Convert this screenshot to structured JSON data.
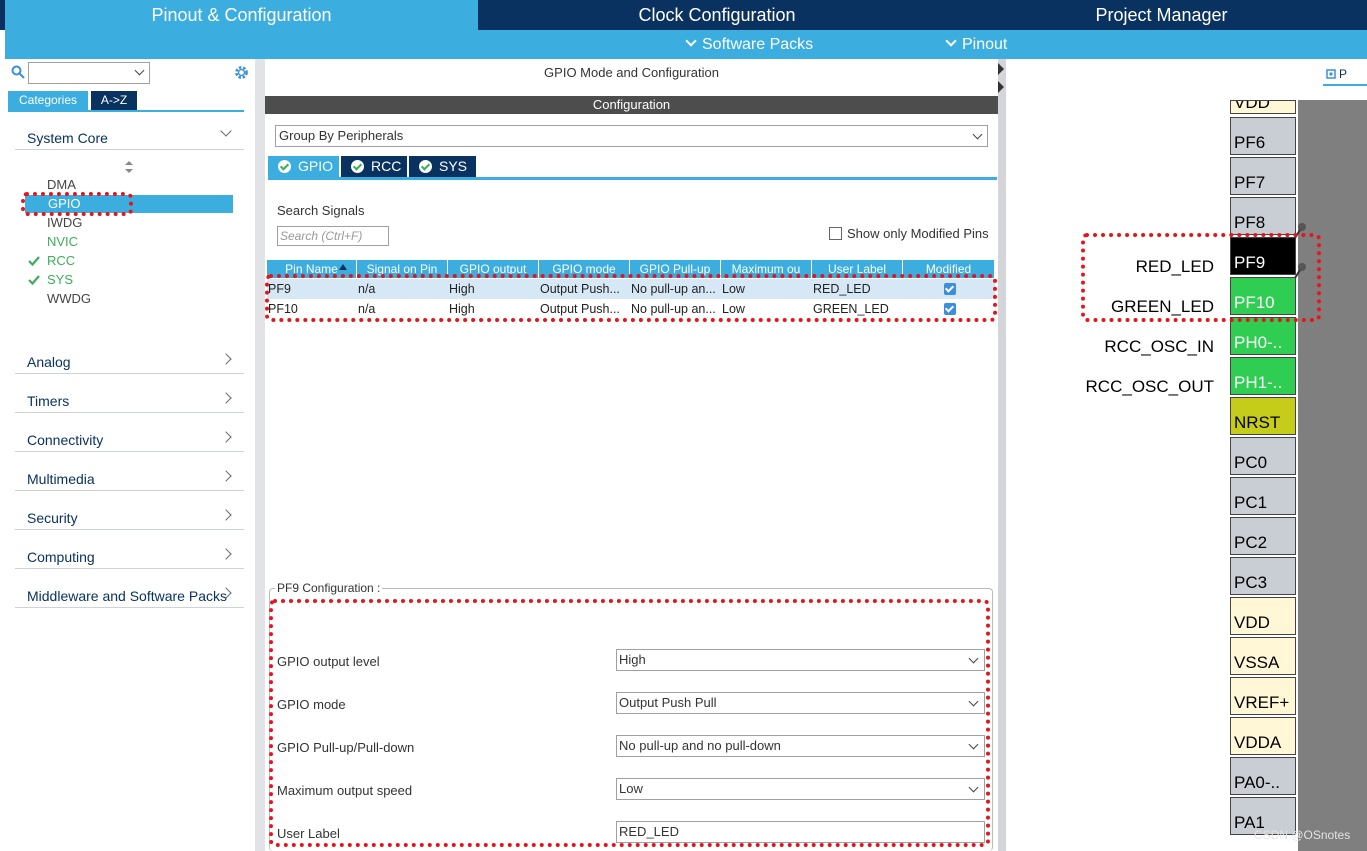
{
  "top_tabs": [
    "Pinout & Configuration",
    "Clock Configuration",
    "Project Manager"
  ],
  "sub_menu": [
    "Software Packs",
    "Pinout"
  ],
  "left": {
    "search_value": "",
    "category_tabs": [
      "Categories",
      "A->Z"
    ],
    "system_core_label": "System Core",
    "core_items": [
      {
        "label": "DMA",
        "state": "normal"
      },
      {
        "label": "GPIO",
        "state": "selected"
      },
      {
        "label": "IWDG",
        "state": "normal"
      },
      {
        "label": "NVIC",
        "state": "green"
      },
      {
        "label": "RCC",
        "state": "checked"
      },
      {
        "label": "SYS",
        "state": "checked"
      },
      {
        "label": "WWDG",
        "state": "normal"
      }
    ],
    "categories": [
      "Analog",
      "Timers",
      "Connectivity",
      "Multimedia",
      "Security",
      "Computing",
      "Middleware and Software Packs"
    ]
  },
  "center": {
    "header": "GPIO Mode and Configuration",
    "config_bar": "Configuration",
    "group_select": "Group By Peripherals",
    "periph_tabs": [
      "GPIO",
      "RCC",
      "SYS"
    ],
    "search_signals_label": "Search Signals",
    "search_placeholder": "Search (Ctrl+F)",
    "show_modified_label": "Show only Modified Pins",
    "table_headers": [
      "Pin Name",
      "Signal on Pin",
      "GPIO output",
      "GPIO mode",
      "GPIO Pull-up",
      "Maximum ou",
      "User Label",
      "Modified"
    ],
    "rows": [
      [
        "PF9",
        "n/a",
        "High",
        "Output Push...",
        "No pull-up an...",
        "Low",
        "RED_LED",
        "true"
      ],
      [
        "PF10",
        "n/a",
        "High",
        "Output Push...",
        "No pull-up an...",
        "Low",
        "GREEN_LED",
        "true"
      ]
    ],
    "pin_config_title": "PF9 Configuration :",
    "pin_config": [
      {
        "label": "GPIO output level",
        "value": "High",
        "type": "select"
      },
      {
        "label": "GPIO mode",
        "value": "Output Push Pull",
        "type": "select"
      },
      {
        "label": "GPIO Pull-up/Pull-down",
        "value": "No pull-up and no pull-down",
        "type": "select"
      },
      {
        "label": "Maximum output speed",
        "value": "Low",
        "type": "select"
      },
      {
        "label": "User Label",
        "value": "RED_LED",
        "type": "text"
      }
    ]
  },
  "right": {
    "view_tab": "P",
    "pins": [
      {
        "name": "VDD",
        "color": "#fff7d6"
      },
      {
        "name": "PF6",
        "color": "#c9ced4"
      },
      {
        "name": "PF7",
        "color": "#c9ced4"
      },
      {
        "name": "PF8",
        "color": "#c9ced4"
      },
      {
        "name": "PF9",
        "color": "#000000",
        "text_color": "#ffffff",
        "signal": "RED_LED"
      },
      {
        "name": "PF10",
        "color": "#2fce52",
        "text_color": "#ffffff",
        "signal": "GREEN_LED"
      },
      {
        "name": "PH0-..",
        "color": "#2fce52",
        "text_color": "#ffffff",
        "signal": "RCC_OSC_IN"
      },
      {
        "name": "PH1-..",
        "color": "#2fce52",
        "text_color": "#ffffff",
        "signal": "RCC_OSC_OUT"
      },
      {
        "name": "NRST",
        "color": "#c6cc1a"
      },
      {
        "name": "PC0",
        "color": "#c9ced4"
      },
      {
        "name": "PC1",
        "color": "#c9ced4"
      },
      {
        "name": "PC2",
        "color": "#c9ced4"
      },
      {
        "name": "PC3",
        "color": "#c9ced4"
      },
      {
        "name": "VDD",
        "color": "#fff7d6"
      },
      {
        "name": "VSSA",
        "color": "#fff7d6"
      },
      {
        "name": "VREF+",
        "color": "#fff7d6"
      },
      {
        "name": "VDDA",
        "color": "#fff7d6"
      },
      {
        "name": "PA0-..",
        "color": "#c9ced4"
      },
      {
        "name": "PA1",
        "color": "#c9ced4"
      }
    ],
    "watermark": "CSDN @OSnotes"
  }
}
